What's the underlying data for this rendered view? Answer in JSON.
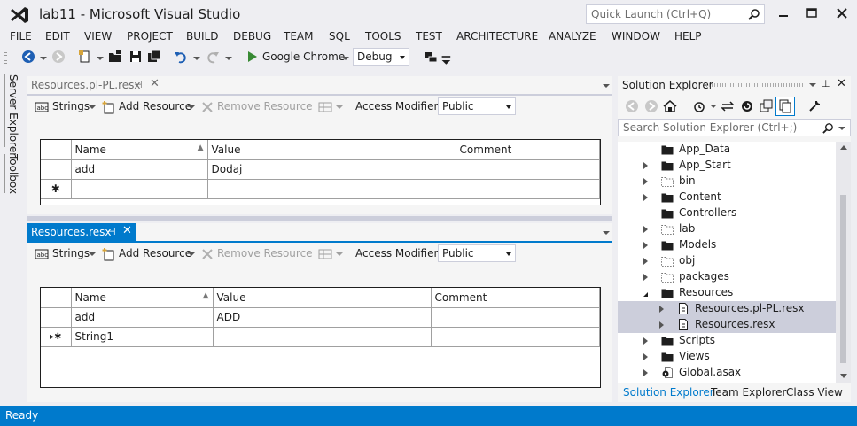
{
  "window": {
    "title": "lab11 - Microsoft Visual Studio",
    "quick_launch_placeholder": "Quick Launch (Ctrl+Q)"
  },
  "menu": [
    "FILE",
    "EDIT",
    "VIEW",
    "PROJECT",
    "BUILD",
    "DEBUG",
    "TEAM",
    "SQL",
    "TOOLS",
    "TEST",
    "ARCHITECTURE",
    "ANALYZE",
    "WINDOW",
    "HELP"
  ],
  "toolbar": {
    "run_target": "Google Chrome",
    "configuration": "Debug"
  },
  "side_tabs": [
    "Server Explorer",
    "Toolbox"
  ],
  "editors": [
    {
      "tab": "Resources.pl-PL.resx",
      "active": false,
      "toolbar": {
        "strings": "Strings",
        "add_resource": "Add Resource",
        "remove_resource": "Remove Resource",
        "access_modifier_label": "Access Modifier:",
        "access_modifier_value": "Public"
      },
      "columns": [
        "Name",
        "Value",
        "Comment"
      ],
      "rows": [
        {
          "marker": "",
          "name": "add",
          "value": "Dodaj",
          "comment": ""
        },
        {
          "marker": "✱",
          "name": "",
          "value": "",
          "comment": ""
        }
      ]
    },
    {
      "tab": "Resources.resx",
      "active": true,
      "toolbar": {
        "strings": "Strings",
        "add_resource": "Add Resource",
        "remove_resource": "Remove Resource",
        "access_modifier_label": "Access Modifier:",
        "access_modifier_value": "Public"
      },
      "columns": [
        "Name",
        "Value",
        "Comment"
      ],
      "rows": [
        {
          "marker": "",
          "name": "add",
          "value": "ADD",
          "comment": ""
        },
        {
          "marker": "▸✱",
          "name": "String1",
          "value": "",
          "comment": ""
        }
      ]
    }
  ],
  "solution_explorer": {
    "title": "Solution Explorer",
    "search_placeholder": "Search Solution Explorer (Ctrl+;)",
    "items": [
      {
        "label": "App_Data",
        "expander": "none",
        "icon": "folder-icon",
        "level": 0,
        "selected": false
      },
      {
        "label": "App_Start",
        "expander": "collapsed",
        "icon": "folder-icon",
        "level": 0,
        "selected": false
      },
      {
        "label": "bin",
        "expander": "collapsed",
        "icon": "dashed-folder-icon",
        "level": 0,
        "selected": false
      },
      {
        "label": "Content",
        "expander": "collapsed",
        "icon": "folder-icon",
        "level": 0,
        "selected": false
      },
      {
        "label": "Controllers",
        "expander": "none",
        "icon": "folder-icon",
        "level": 0,
        "selected": false
      },
      {
        "label": "lab",
        "expander": "collapsed",
        "icon": "dashed-folder-icon",
        "level": 0,
        "selected": false
      },
      {
        "label": "Models",
        "expander": "collapsed",
        "icon": "folder-icon",
        "level": 0,
        "selected": false
      },
      {
        "label": "obj",
        "expander": "collapsed",
        "icon": "dashed-folder-icon",
        "level": 0,
        "selected": false
      },
      {
        "label": "packages",
        "expander": "collapsed",
        "icon": "dashed-folder-icon",
        "level": 0,
        "selected": false
      },
      {
        "label": "Resources",
        "expander": "expanded",
        "icon": "folder-icon",
        "level": 0,
        "selected": false
      },
      {
        "label": "Resources.pl-PL.resx",
        "expander": "collapsed",
        "icon": "file-icon",
        "level": 1,
        "selected": true
      },
      {
        "label": "Resources.resx",
        "expander": "collapsed",
        "icon": "file-icon",
        "level": 1,
        "selected": true
      },
      {
        "label": "Scripts",
        "expander": "collapsed",
        "icon": "folder-icon",
        "level": 0,
        "selected": false
      },
      {
        "label": "Views",
        "expander": "collapsed",
        "icon": "folder-icon",
        "level": 0,
        "selected": false
      },
      {
        "label": "Global.asax",
        "expander": "collapsed",
        "icon": "gear-file-icon",
        "level": 0,
        "selected": false
      }
    ],
    "bottom_tabs": [
      "Solution Explorer",
      "Team Explorer",
      "Class View"
    ]
  },
  "status": {
    "text": "Ready"
  },
  "colors": {
    "accent": "#007acc",
    "background": "#eeeef2",
    "selection": "#cccedb",
    "run_green": "#388a34",
    "undo_blue": "#1e5fb4"
  }
}
